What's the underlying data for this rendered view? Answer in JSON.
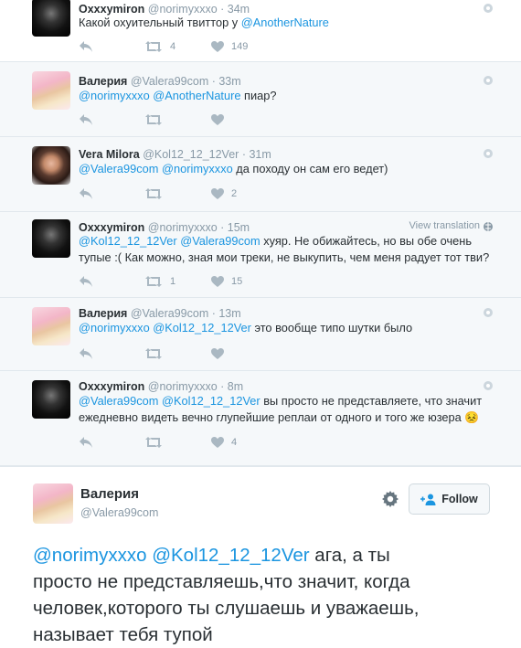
{
  "tweets": [
    {
      "name": "Oxxxymiron",
      "handle": "@norimyxxxo",
      "time": "· 34m",
      "mentions_prefix": "",
      "text_before": "Какой охуительный твиттор у ",
      "mention1": "@AnotherNature",
      "text_after": "",
      "retweets": "4",
      "likes": "149",
      "avatar_icon": "dark-avatar"
    },
    {
      "name": "Валерия",
      "handle": "@Valera99com",
      "time": "· 33m",
      "mention1": "@norimyxxxo",
      "mention2": "@AnotherNature",
      "text_after": " пиар?",
      "retweets": "",
      "likes": ""
    },
    {
      "name": "Vera Milora",
      "handle": "@Kol12_12_12Ver",
      "time": "· 31m",
      "mention1": "@Valera99com",
      "mention2": "@norimyxxxo",
      "text_after": " да походу он сам его ведет)",
      "retweets": "",
      "likes": "2"
    },
    {
      "name": "Oxxxymiron",
      "handle": "@norimyxxxo",
      "time": "· 15m",
      "view_translation": "View translation",
      "mention1": "@Kol12_12_12Ver",
      "mention2": "@Valera99com",
      "text_after": " хуяр. Не обижайтесь, но вы обе очень",
      "line2": "тупые :( Как можно, зная мои треки, не выкупить, чем меня радует тот тви?",
      "retweets": "1",
      "likes": "15"
    },
    {
      "name": "Валерия",
      "handle": "@Valera99com",
      "time": "· 13m",
      "mention1": "@norimyxxxo",
      "mention2": "@Kol12_12_12Ver",
      "text_after": " это вообще типо шутки было",
      "retweets": "",
      "likes": ""
    },
    {
      "name": "Oxxxymiron",
      "handle": "@norimyxxxo",
      "time": "· 8m",
      "mention1": "@Valera99com",
      "mention2": "@Kol12_12_12Ver",
      "text_after": " вы просто не представляете, что значит",
      "line2": "ежедневно видеть вечно глупейшие реплаи от одного и того же юзера 😣",
      "retweets": "",
      "likes": "4"
    }
  ],
  "expanded": {
    "name": "Валерия",
    "handle": "@Valera99com",
    "follow_label": "Follow",
    "mention1": "@norimyxxxo",
    "mention2": "@Kol12_12_12Ver",
    "text_after": " ага, а ты",
    "line2": "просто не представляешь,что значит, когда",
    "line3": "человек,которого ты слушаешь и уважаешь,",
    "line4": "называет тебя тупой"
  },
  "colors": {
    "link": "#1b95e0",
    "muted": "#8899a6",
    "icon": "#aab8c2",
    "text": "#292f33"
  }
}
